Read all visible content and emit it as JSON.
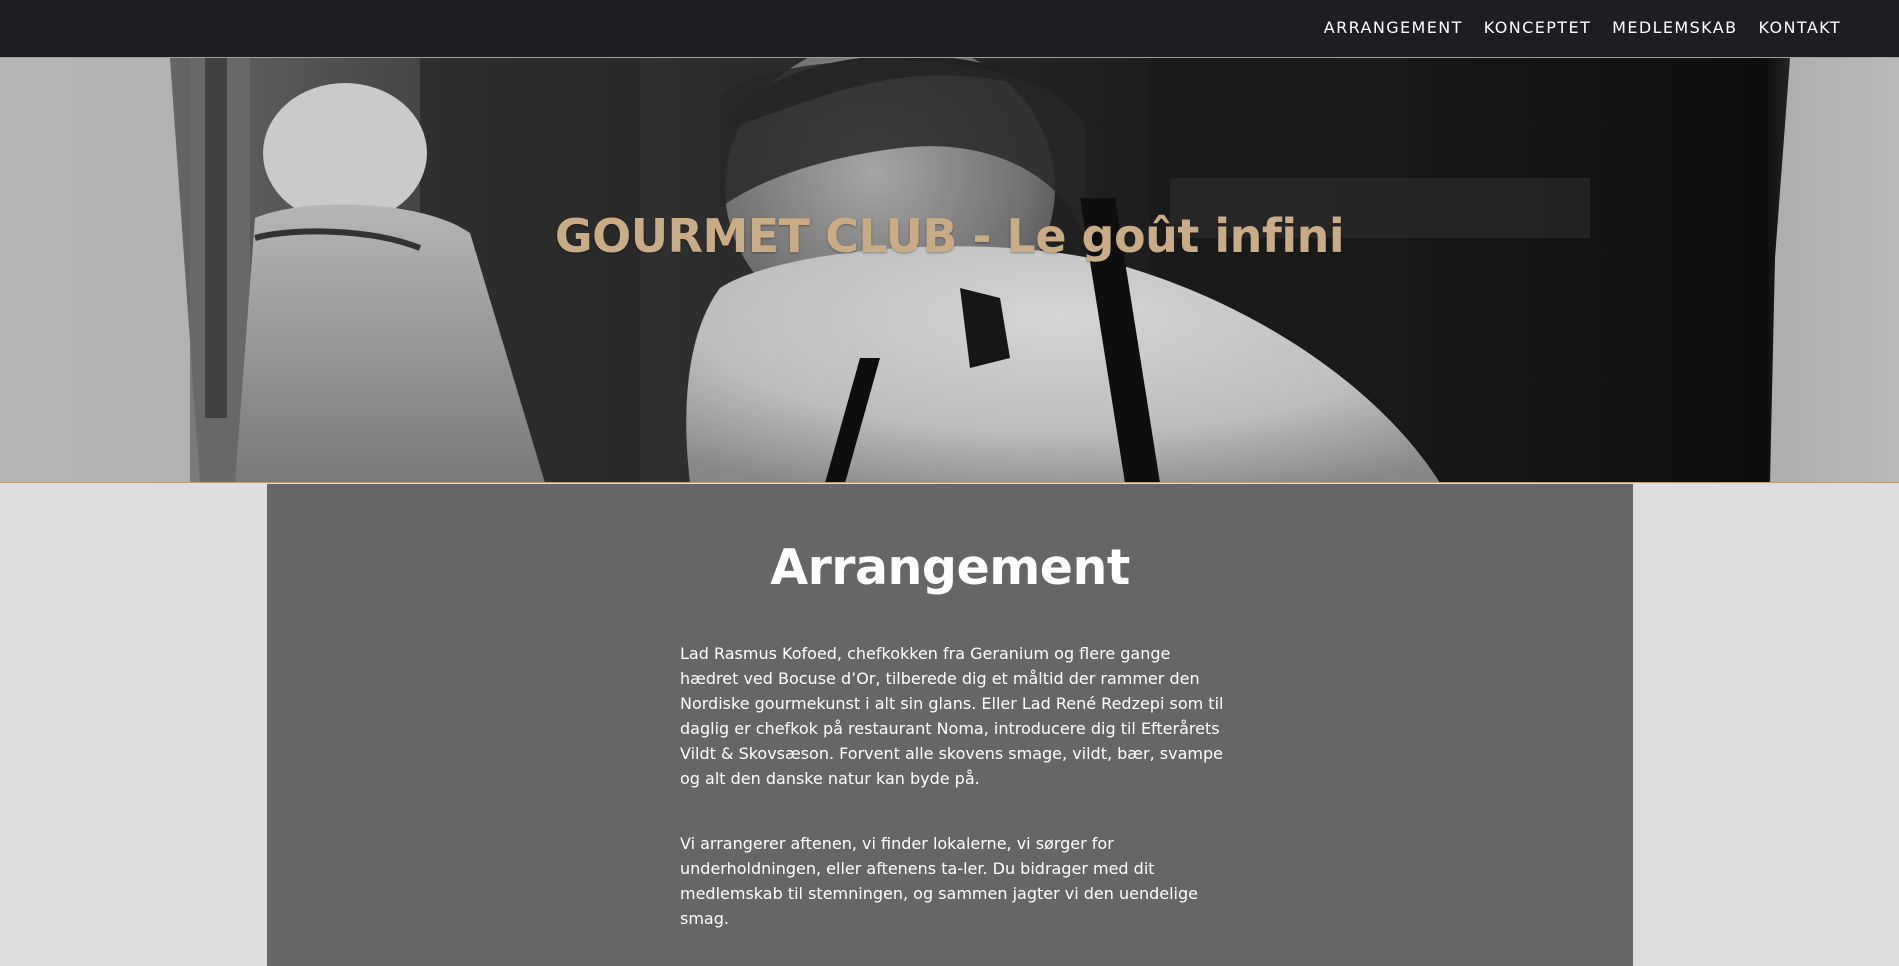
{
  "nav": {
    "items": [
      {
        "label": "ARRANGEMENT"
      },
      {
        "label": "KONCEPTET"
      },
      {
        "label": "MEDLEMSKAB"
      },
      {
        "label": "KONTAKT"
      }
    ]
  },
  "hero": {
    "title": "GOURMET CLUB - Le goût infini"
  },
  "section": {
    "title": "Arrangement",
    "paragraphs": [
      "Lad Rasmus Kofoed, chefkokken fra Geranium og flere gange hædret ved Bocuse d’Or, tilberede dig et måltid der rammer den Nordiske gourmekunst i alt sin glans. Eller Lad René Redzepi som til daglig er chefkok på restaurant Noma, introducere dig til Efterårets Vildt & Skovsæson. Forvent alle skovens smage, vildt, bær, svampe og alt den danske natur kan byde på.",
      "Vi arrangerer aftenen, vi finder lokalerne, vi sørger for underholdningen, eller aftenens ta-ler. Du bidrager med dit medlemskab til stemningen, og sammen jagter vi den uendelige smag."
    ]
  },
  "colors": {
    "nav_background": "#1d1e21",
    "accent_gold": "#c9ac86",
    "content_background": "#666666",
    "page_background": "#dedede"
  }
}
